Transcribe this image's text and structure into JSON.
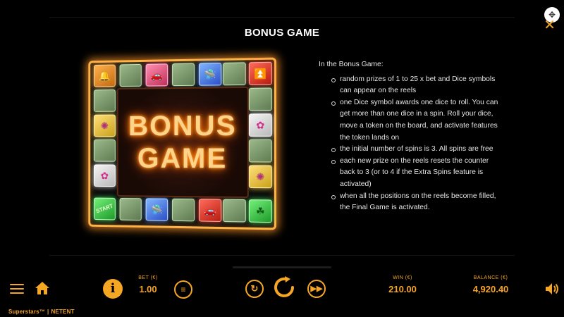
{
  "header": {
    "title": "BONUS GAME"
  },
  "close_icon": "close-icon",
  "board": {
    "center_line1": "BONUS",
    "center_line2": "GAME",
    "start_label": "START"
  },
  "rules": {
    "intro": "In the Bonus Game:",
    "items": [
      "random prizes of 1 to 25 x bet and Dice symbols can appear on the reels",
      "one Dice symbol awards one dice to roll. You can get more than one dice in a spin. Roll your dice, move a token on the board, and activate features the token lands on",
      "the initial number of spins is 3. All spins are free",
      "each new prize on the reels resets the counter back to 3 (or to 4 if the Extra Spins feature is activated)",
      "when all the positions on the reels become filled, the Final Game is activated."
    ]
  },
  "bottom_bar": {
    "bet_label": "BET (€)",
    "bet_value": "1.00",
    "win_label": "WIN (€)",
    "win_value": "210.00",
    "balance_label": "BALANCE (€)",
    "balance_value": "4,920.40",
    "info_symbol": "i"
  },
  "footer": {
    "brand_left": "Superstars™",
    "brand_right": "NETENT"
  },
  "colors": {
    "accent": "#f5a623",
    "board_glow": "#ff9a2a"
  }
}
